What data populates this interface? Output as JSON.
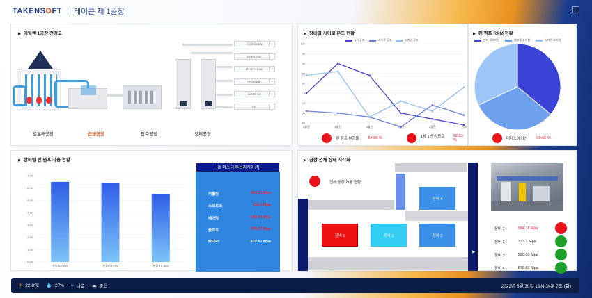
{
  "header": {
    "logo_main": "TAKENS",
    "logo_o": "O",
    "logo_tail": "FT",
    "factory": "테이큰 제 1공장"
  },
  "process": {
    "title": "에틸렌 1공장 전경도",
    "gases": [
      "HYDROGEN",
      "ETHYLENE",
      "PROPYLENE",
      "PROPANE",
      "MIXED C4",
      "PG"
    ],
    "arrow": "›",
    "stages": [
      {
        "label": "열분해공정",
        "active": false
      },
      {
        "label": "급냉공정",
        "active": true
      },
      {
        "label": "압축공정",
        "active": false
      },
      {
        "label": "정제공정",
        "active": false
      }
    ]
  },
  "temp": {
    "title": "장비별 사이로 온도 현황",
    "chart_data": {
      "type": "line",
      "categories": [
        "6월전",
        "5월전",
        "4월전",
        "3월전",
        "2월전",
        "현재"
      ],
      "ylim": [
        60,
        100
      ],
      "yticks": [
        60,
        65,
        70,
        75,
        80,
        85,
        90,
        95,
        100
      ],
      "series": [
        {
          "name": "1차 공조",
          "color": "#4a44c8",
          "values": [
            75,
            90,
            84,
            65,
            62,
            59
          ]
        },
        {
          "name": "사이로 공조",
          "color": "#6a7fd6",
          "values": [
            66,
            65,
            63,
            58,
            69,
            64
          ]
        },
        {
          "name": "스파인 공조",
          "color": "#8fbdf2",
          "values": [
            84,
            86,
            63,
            71,
            66,
            78
          ]
        }
      ]
    },
    "indicators": [
      {
        "label": "팬 펌프 부하율 :",
        "value": "54.85 %"
      },
      {
        "label": "1차 1번 리모트 :",
        "value": "62.83 %"
      }
    ]
  },
  "rpm": {
    "title": "팬 펌프 RPM 현황",
    "chart_data": {
      "type": "pie",
      "labels": [
        "팬프 로테이션",
        "냉방용 호리원",
        "스프린 호리원"
      ],
      "values": [
        36,
        32,
        32
      ],
      "colors": [
        "#3a43d6",
        "#6da1ee",
        "#9dc6f7"
      ]
    },
    "indicator": {
      "label": "머테노에이션 :",
      "value": "99.66 %"
    }
  },
  "usage": {
    "title": "장비별 펜 펌프 사용 현황",
    "chart_data": {
      "type": "bar",
      "categories": [
        "펜펌프A MW",
        "펜펌프B MW",
        "펜펌프C MW"
      ],
      "values": [
        6.5,
        6.4,
        5.5
      ],
      "ylim": [
        0,
        7
      ],
      "yticks": [
        "0.00",
        "1.00",
        "2.00",
        "3.00",
        "4.00",
        "5.00",
        "6.00",
        "7.00"
      ]
    },
    "realtime": {
      "title": "[폴 마스터 투브리케이션]",
      "rows": [
        {
          "label": "커플링",
          "value": "904.11 Mpa",
          "red": true
        },
        {
          "label": "스프로크",
          "value": "733.1 Mpa",
          "red": true
        },
        {
          "label": "베어링",
          "value": "580.03 Mpa",
          "red": true
        },
        {
          "label": "풀로트",
          "value": "870.67 Mpa",
          "red": true
        },
        {
          "label": "MESH",
          "value": "870.67 Mpa",
          "red": false
        }
      ]
    }
  },
  "layout": {
    "title": "공장 전체 상태 시각화",
    "alarm": "전체 공장 가동 현황",
    "machines": [
      "장비 1",
      "장비 2",
      "장비 3",
      "장비 4"
    ],
    "equipment": [
      {
        "label": "장비 1 :",
        "value": "904.11 Mpa",
        "status": "red"
      },
      {
        "label": "장비 2 :",
        "value": "733.1 Mpa",
        "status": "green"
      },
      {
        "label": "장비 3 :",
        "value": "580.03 Mpa",
        "status": "green"
      },
      {
        "label": "장비 4 :",
        "value": "870.67 Mpa",
        "status": "green"
      }
    ]
  },
  "status": {
    "temp": "22.8℃",
    "humidity": "27%",
    "item3": "나쁨",
    "item4": "좋음",
    "datetime": "2023년 5월 30일 13시 34분 7초 (화)"
  }
}
